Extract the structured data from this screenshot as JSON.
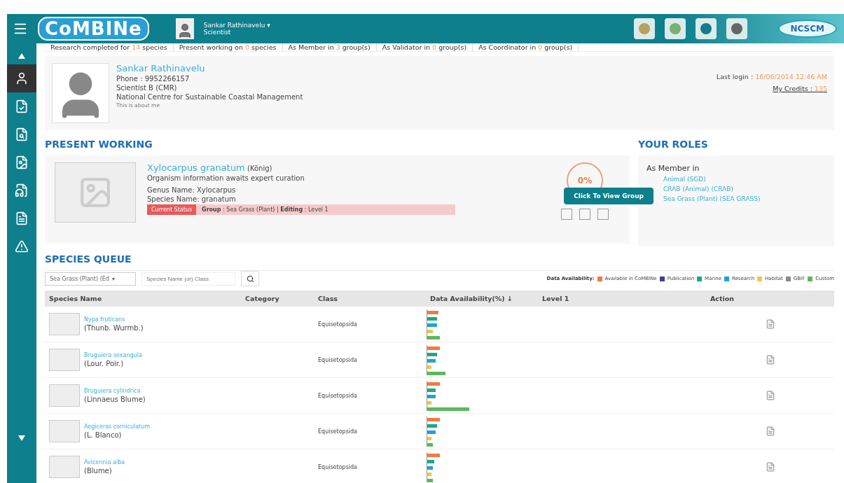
{
  "header": {
    "logo": "CoMBINe",
    "user_name": "Sankar Rathinavelu",
    "user_role": "Scientist",
    "user_caret": "▾",
    "partner_logo": "NCSCM"
  },
  "sidebar": {
    "items": [
      {
        "selected": true
      },
      {
        "selected": false
      },
      {
        "selected": false
      },
      {
        "selected": false
      },
      {
        "selected": false
      },
      {
        "selected": false
      },
      {
        "selected": false
      }
    ]
  },
  "stats": [
    {
      "before": "Research completed for ",
      "count": "14",
      "after": " species"
    },
    {
      "before": "Present working on ",
      "count": "0",
      "after": " species"
    },
    {
      "before": "As Member in ",
      "count": "3",
      "after": " group(s)"
    },
    {
      "before": "As Validator in ",
      "count": "0",
      "after": " group(s)"
    },
    {
      "before": "As Coordinator in ",
      "count": "0",
      "after": " group(s)"
    }
  ],
  "profile": {
    "name": "Sankar Rathinavelu",
    "phone": "Phone : 9952266157",
    "designation": "Scientist B (CMR)",
    "organization": "National Centre for Sustainable Coastal Management",
    "about": "This is about me",
    "last_login_label": "Last login : ",
    "last_login": "16/06/2014 12:46 AM",
    "credits_label": "My Credits : ",
    "credits": "135"
  },
  "present_working": {
    "heading": "PRESENT WORKING",
    "species": "Xylocarpus granatum",
    "author": "(König)",
    "note": "Organism information awaits expert curation",
    "genus": "Genus Name: Xylocarpus",
    "species_name": "Species Name: granatum",
    "status_badge": "Current Status",
    "status_group_label": "Group",
    "status_group": " : Sea Grass (Plant) | ",
    "status_edit_label": "Editing",
    "status_edit": " : Level 1",
    "progress": "0%",
    "tooltip": "Click To View Group"
  },
  "roles": {
    "heading": "YOUR ROLES",
    "title": "As Member in",
    "groups": [
      "Animal (SGD)",
      "CRAB (Animal) (CRAB)",
      "Sea Grass (Plant) (SEA GRASS)"
    ]
  },
  "queue": {
    "heading": "SPECIES QUEUE",
    "group_select": "Sea Grass (Plant) (Ed",
    "group_select_caret": "▾",
    "search": {
      "placeholder": "Species Name (or) Class"
    },
    "legend_title": "Data Availability:",
    "legend": [
      {
        "label": "Available in CoMBINe",
        "color": "#f07b3f"
      },
      {
        "label": "Publication",
        "color": "#3d3f8f"
      },
      {
        "label": "Marine",
        "color": "#1aa88a"
      },
      {
        "label": "Research",
        "color": "#1ea3d6"
      },
      {
        "label": "Habitat",
        "color": "#f4c542"
      },
      {
        "label": "GBIF",
        "color": "#8a8a8a"
      },
      {
        "label": "Custom",
        "color": "#5cb85c"
      }
    ],
    "columns": [
      "Species Name",
      "Category",
      "Class",
      "Data Availability(%) ↓",
      "Level 1",
      "Action"
    ],
    "rows": [
      {
        "name": "Nypa fruticans",
        "author": "(Thunb. Wurmb.)",
        "class": "Equisetopsida"
      },
      {
        "name": "Bruguiera sexangula",
        "author": "(Lour. Poir.)",
        "class": "Equisetopsida"
      },
      {
        "name": "Bruguiera cylindrica",
        "author": "(Linnaeus Blume)",
        "class": "Equisetopsida"
      },
      {
        "name": "Aegiceras corniculatum",
        "author": "(L. Blanco)",
        "class": "Equisetopsida"
      },
      {
        "name": "Avicennia alba",
        "author": "(Blume)",
        "class": "Equisetopsida"
      }
    ]
  }
}
